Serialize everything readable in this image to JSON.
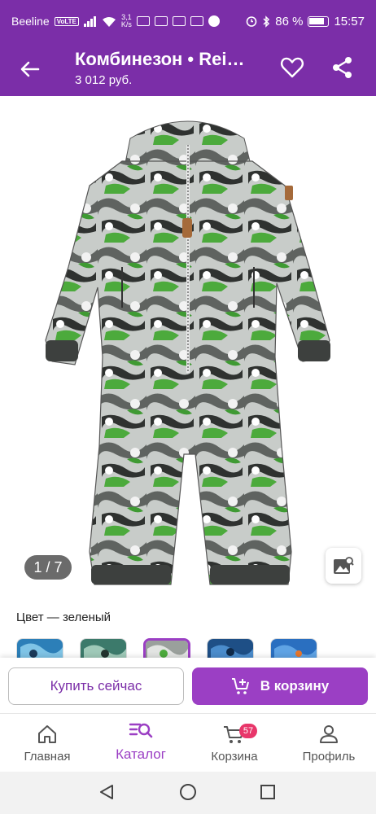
{
  "status_bar": {
    "carrier": "Beeline",
    "volte": "VoLTE",
    "speed_value": "3,1",
    "speed_unit": "K/s",
    "battery": "86 %",
    "time": "15:57"
  },
  "header": {
    "title": "Комбинезон • Rei…",
    "price": "3 012 руб."
  },
  "gallery": {
    "counter": "1 / 7"
  },
  "color": {
    "label": "Цвет — зеленый",
    "swatches": [
      "blue-print",
      "teal-print",
      "green-print",
      "navy-print",
      "blue-orange-print"
    ],
    "selected_index": 2
  },
  "actions": {
    "buy_now": "Купить сейчас",
    "add_to_cart": "В корзину"
  },
  "bottom_nav": {
    "items": [
      {
        "label": "Главная",
        "icon": "home-icon"
      },
      {
        "label": "Каталог",
        "icon": "catalog-search-icon"
      },
      {
        "label": "Корзина",
        "icon": "cart-icon",
        "badge": "57"
      },
      {
        "label": "Профиль",
        "icon": "profile-icon"
      }
    ],
    "active_index": 1
  },
  "colors": {
    "brand": "#7b2ea8",
    "accent": "#9b3fc4",
    "badge": "#e8366a"
  }
}
